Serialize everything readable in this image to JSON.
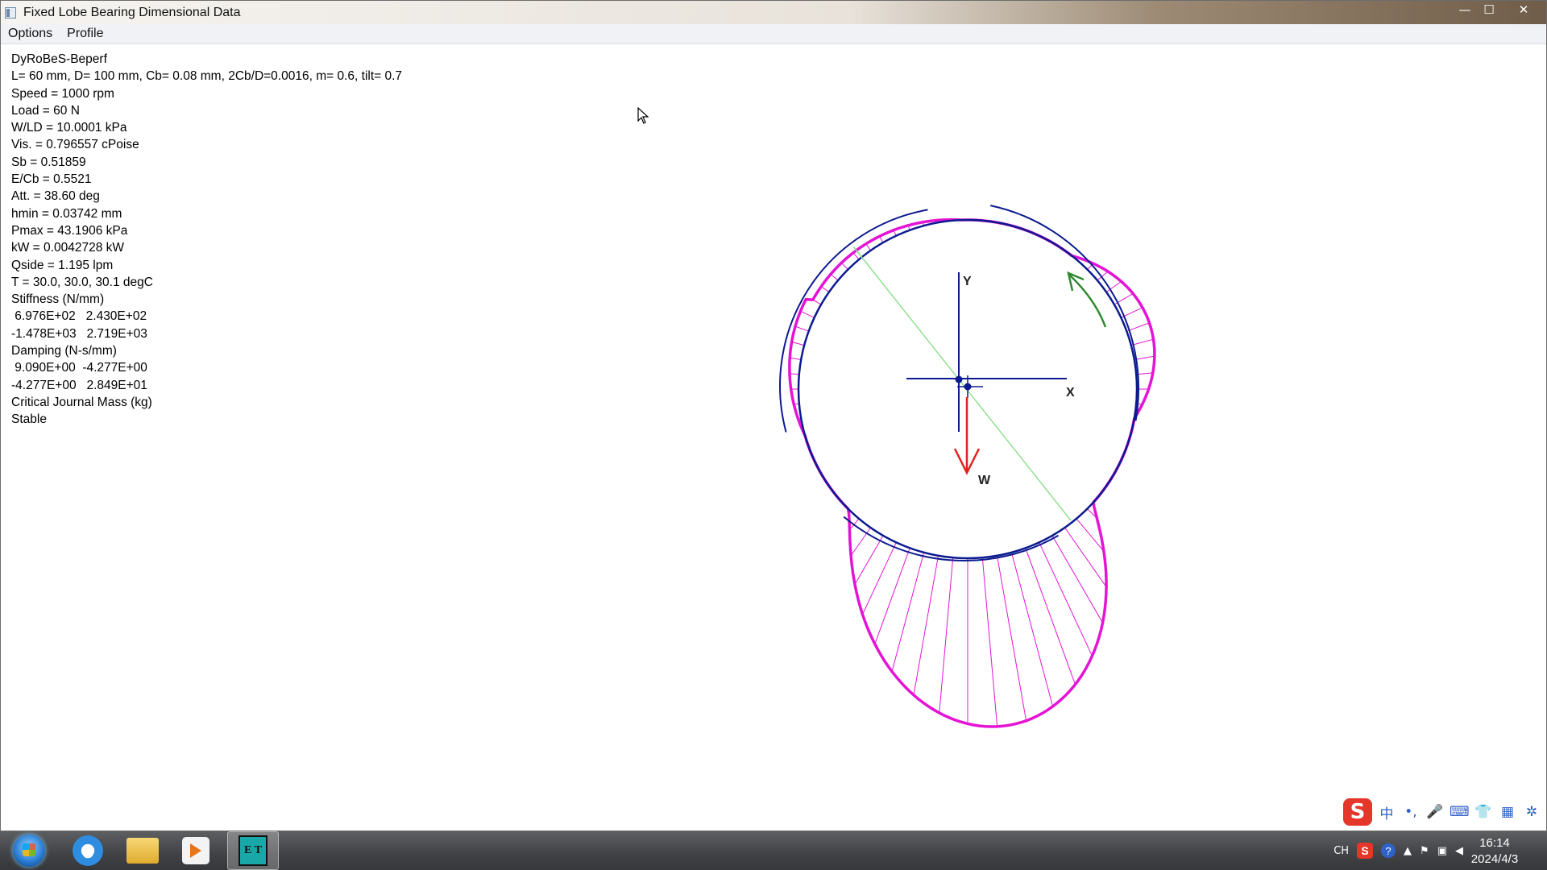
{
  "window": {
    "title": "Fixed Lobe Bearing Dimensional Data",
    "controls": {
      "minimize": "—",
      "maximize": "☐",
      "close": "✕"
    }
  },
  "menu": [
    "Options",
    "Profile"
  ],
  "results": [
    "DyRoBeS-Beperf",
    "L= 60 mm, D= 100 mm, Cb= 0.08 mm, 2Cb/D=0.0016, m= 0.6, tilt= 0.7",
    "Speed = 1000 rpm",
    "Load = 60 N",
    "W/LD = 10.0001 kPa",
    "Vis. = 0.796557 cPoise",
    "Sb = 0.51859",
    "E/Cb = 0.5521",
    "Att. = 38.60 deg",
    "hmin = 0.03742 mm",
    "Pmax = 43.1906 kPa",
    "kW = 0.0042728 kW",
    "Qside = 1.195 lpm",
    "T = 30.0, 30.0, 30.1 degC",
    "Stiffness (N/mm)",
    " 6.976E+02   2.430E+02",
    "-1.478E+03   2.719E+03",
    "Damping (N-s/mm)",
    " 9.090E+00  -4.277E+00",
    "-4.277E+00   2.849E+01",
    "Critical Journal Mass (kg)",
    "Stable"
  ],
  "diagram": {
    "axis_labels": {
      "y": "Y",
      "x": "X",
      "load": "W"
    },
    "colors": {
      "pad": "#0b1a8f",
      "journal": "#0b1a8f",
      "pressure": "#e413d6",
      "load": "#e0211e",
      "rotation": "#2f8a2f",
      "attitude_line": "#8fe08f"
    }
  },
  "ime_bar": {
    "logo": "S",
    "icons": [
      "中",
      "•,",
      "🎤",
      "⌨",
      "👕",
      "▦",
      "✲"
    ]
  },
  "taskbar": {
    "tray": [
      "CH",
      "S",
      "?",
      "▲",
      "⚑",
      "▣",
      "◀"
    ],
    "time": "16:14",
    "date": "2024/4/3",
    "app_icon_text": "E T"
  }
}
